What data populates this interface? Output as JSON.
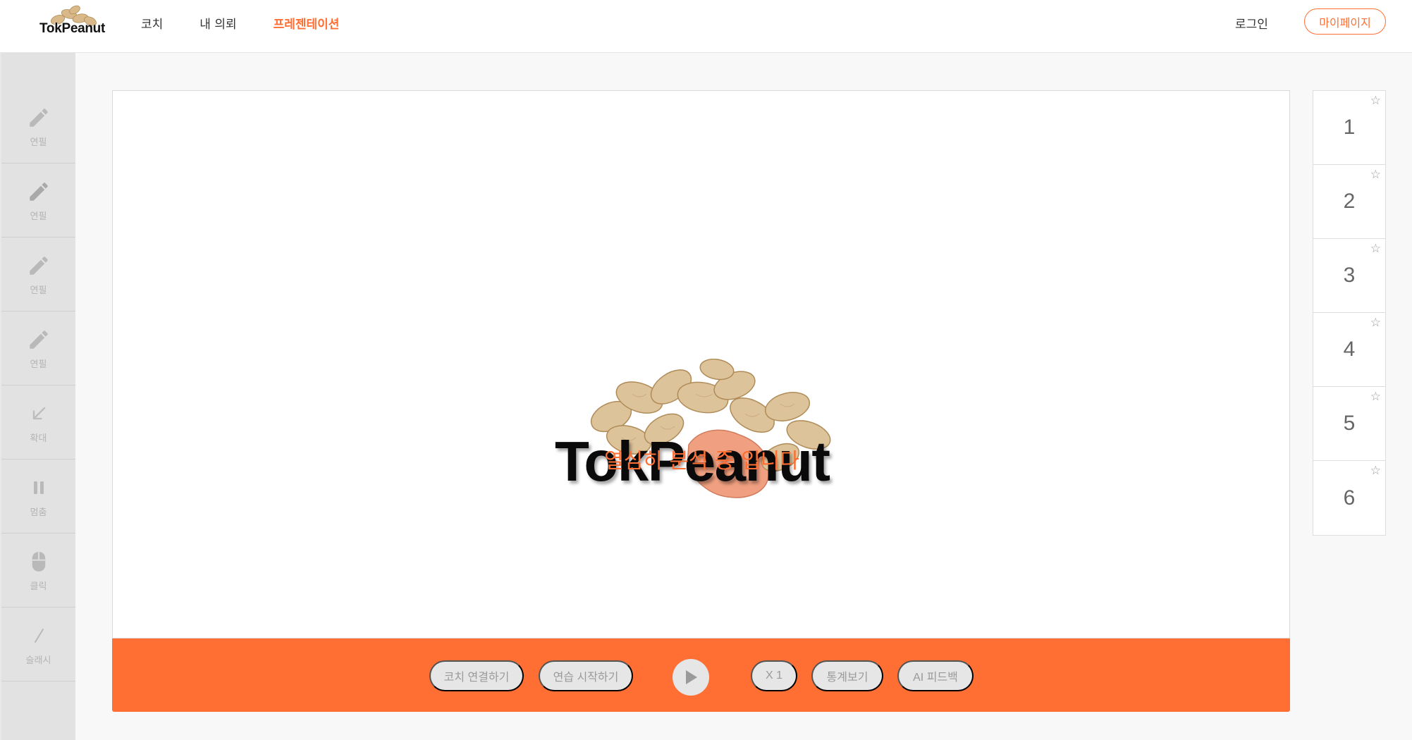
{
  "header": {
    "logo_text": "TokPeanut",
    "nav": [
      {
        "label": "코치"
      },
      {
        "label": "내 의뢰"
      },
      {
        "label": "프레젠테이션"
      }
    ],
    "login_label": "로그인",
    "mypage_label": "마이페이지",
    "accent_color": "#ff6f34"
  },
  "sidebar": {
    "tools": [
      {
        "label": "연필",
        "icon": "pencil-icon"
      },
      {
        "label": "연필",
        "icon": "pencil-icon"
      },
      {
        "label": "연필",
        "icon": "pencil-icon"
      },
      {
        "label": "연필",
        "icon": "pencil-icon"
      },
      {
        "label": "확대",
        "icon": "zoom-arrow-icon"
      },
      {
        "label": "멈춤",
        "icon": "pause-icon"
      },
      {
        "label": "클릭",
        "icon": "mouse-icon"
      },
      {
        "label": "슬래시",
        "icon": "slash-icon"
      }
    ]
  },
  "stage": {
    "hero_text": "TokPeanut",
    "status_text": "열심히 분석 중 입니다"
  },
  "controls": {
    "coach_connect": "코치 연결하기",
    "start_practice": "연습 시작하기",
    "play_icon": "play-icon",
    "speed": "X 1",
    "stats": "통계보기",
    "ai_feedback": "AI 피드백"
  },
  "slides": {
    "items": [
      "1",
      "2",
      "3",
      "4",
      "5",
      "6"
    ],
    "star_glyph": "☆"
  }
}
